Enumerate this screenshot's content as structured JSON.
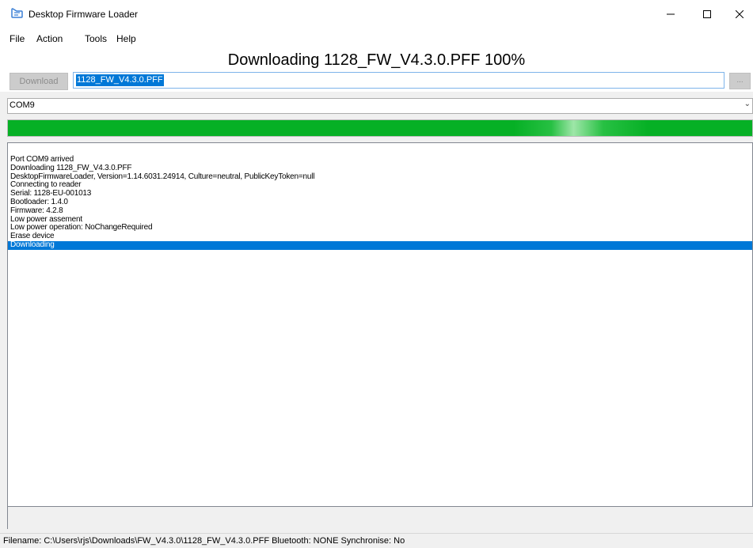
{
  "window": {
    "title": "Desktop Firmware Loader",
    "icon": "app-icon",
    "controls": {
      "minimize": "—",
      "maximize": "☐",
      "close": "✕"
    }
  },
  "menu": {
    "items": [
      "File",
      "Action",
      "Tools",
      "Help"
    ]
  },
  "heading": "Downloading 1128_FW_V4.3.0.PFF 100%",
  "toolbar": {
    "download_label": "Download",
    "filename_value": "1128_FW_V4.3.0.PFF",
    "browse_label": "..."
  },
  "port": {
    "selected": "COM9",
    "chevron_icon": "chevron-down-icon"
  },
  "progress": {
    "percent": 100,
    "color": "#06b025"
  },
  "log": {
    "lines": [
      "Port COM9 arrived",
      "Downloading 1128_FW_V4.3.0.PFF",
      "DesktopFirmwareLoader, Version=1.14.6031.24914, Culture=neutral, PublicKeyToken=null",
      "Connecting to reader",
      "Serial: 1128-EU-001013",
      "Bootloader: 1.4.0",
      "Firmware: 4.2.8",
      "Low power assement",
      "Low power operation: NoChangeRequired",
      "Erase device",
      "Downloading"
    ],
    "selected_index": 10,
    "selection_color": "#0078d7"
  },
  "status": {
    "text": "Filename: C:\\Users\\rjs\\Downloads\\FW_V4.3.0\\1128_FW_V4.3.0.PFF  Bluetooth: NONE  Synchronise: No"
  }
}
